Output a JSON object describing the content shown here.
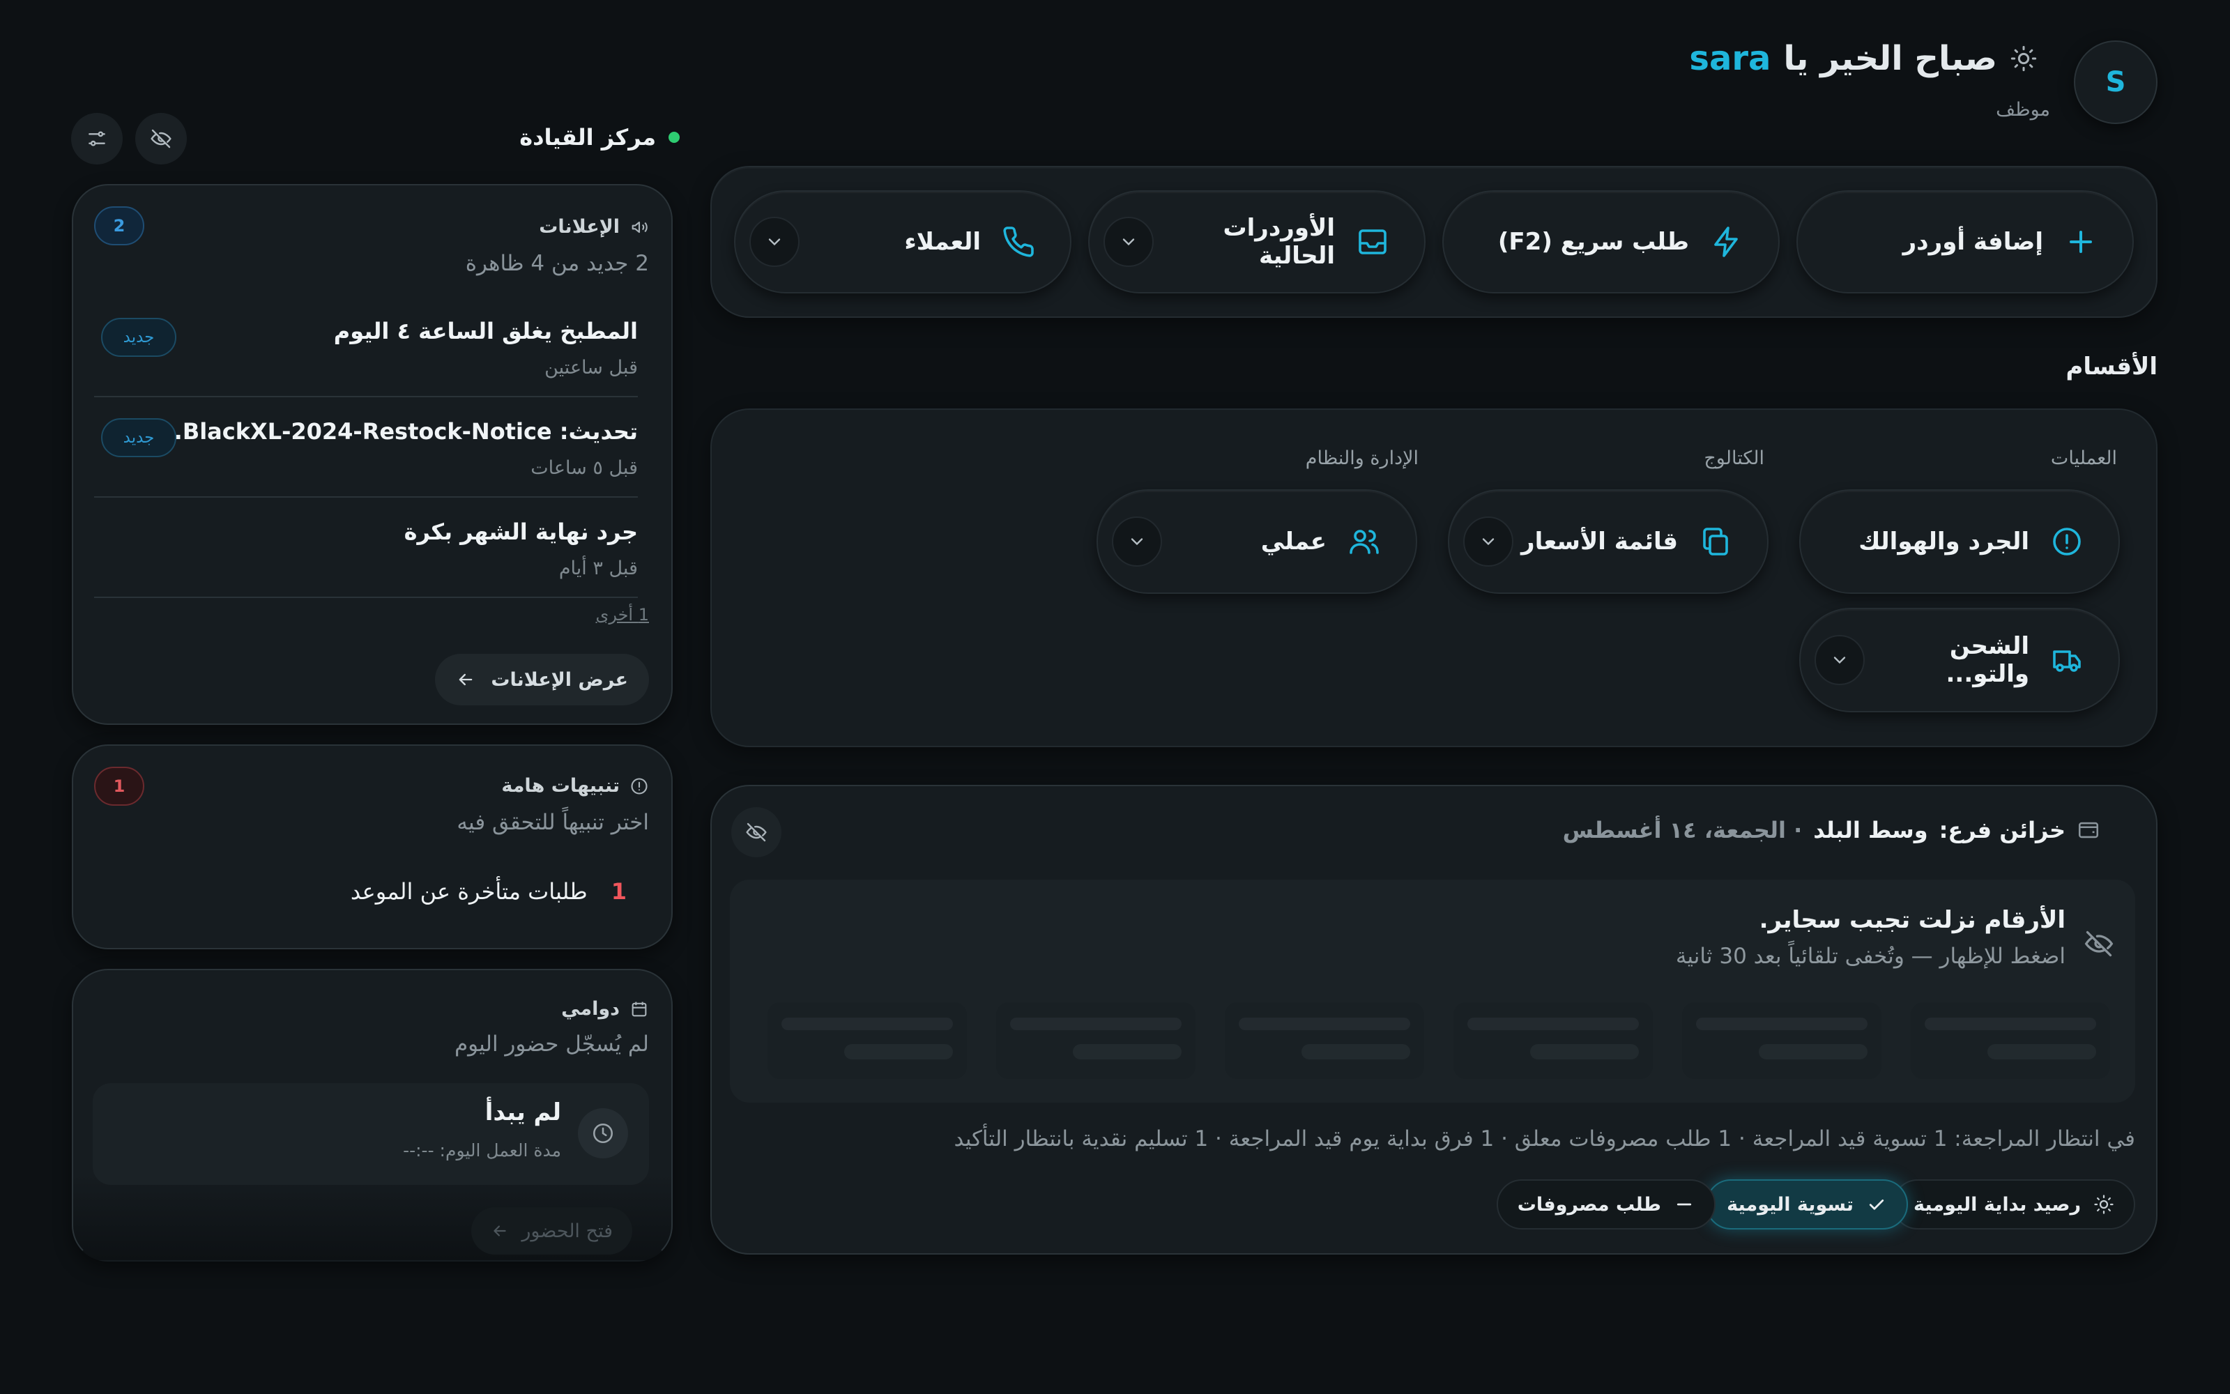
{
  "header": {
    "avatar_letter": "S",
    "greeting": "صباح الخير يا",
    "username": "sara",
    "role": "موظف"
  },
  "quick_actions": [
    {
      "label": "إضافة أوردر",
      "icon": "plus-icon"
    },
    {
      "label": "طلب سريع (F2)",
      "icon": "lightning-icon"
    },
    {
      "label": "الأوردرات الحالية",
      "icon": "inbox-icon",
      "has_dropdown": true
    },
    {
      "label": "العملاء",
      "icon": "phone-icon",
      "has_dropdown": true
    }
  ],
  "sections": {
    "title": "الأقسام",
    "groups": [
      {
        "heading": "العمليات",
        "items": [
          {
            "label": "الجرد والهوالك",
            "icon": "alert-circle-icon"
          },
          {
            "label": "الشحن والتو...",
            "icon": "truck-icon",
            "has_dropdown": true
          }
        ]
      },
      {
        "heading": "الكتالوج",
        "items": [
          {
            "label": "قائمة الأسعار",
            "icon": "copy-icon",
            "has_dropdown": true
          }
        ]
      },
      {
        "heading": "الإدارة والنظام",
        "items": [
          {
            "label": "عملي",
            "icon": "users-icon",
            "has_dropdown": true
          }
        ]
      }
    ]
  },
  "treasury": {
    "label": "خزائن فرع:",
    "branch": "وسط البلد",
    "date": "· الجمعة، ١٤ أغسطس",
    "hidden_title": "الأرقام نزلت تجيب سجاير.",
    "hidden_sub": "اضغط للإظهار — وتُخفى تلقائياً بعد 30 ثانية",
    "pending": "في انتظار المراجعة: 1 تسوية قيد المراجعة · 1 طلب مصروفات معلق · 1 فرق بداية يوم قيد المراجعة · 1 تسليم نقدية بانتظار التأكيد",
    "buttons": [
      {
        "label": "رصيد بداية اليومية",
        "icon": "sun-icon"
      },
      {
        "label": "تسوية اليومية",
        "icon": "check-icon",
        "active": true
      },
      {
        "label": "طلب مصروفات",
        "icon": "minus-icon"
      }
    ]
  },
  "command_center": {
    "title": "مركز القيادة"
  },
  "announcements": {
    "title": "الإعلانات",
    "count": "2",
    "subtitle": "2 جديد من 4 ظاهرة",
    "items": [
      {
        "title": "المطبخ يغلق الساعة ٤ اليوم",
        "time": "قبل ساعتين",
        "badge": "جديد"
      },
      {
        "title": "تحديث: BlackXL-2024-Restock-Notice...",
        "time": "قبل ٥ ساعات",
        "badge": "جديد"
      },
      {
        "title": "جرد نهاية الشهر بكرة",
        "time": "قبل ٣ أيام"
      }
    ],
    "more": "1 أخرى",
    "view_all": "عرض الإعلانات"
  },
  "alerts": {
    "title": "تنبيهات هامة",
    "count": "1",
    "subtitle": "اختر تنبيهاً للتحقق فيه",
    "item_count": "1",
    "item_label": "طلبات متأخرة عن الموعد"
  },
  "attendance": {
    "title": "دوامي",
    "subtitle": "لم يُسجّل حضور اليوم",
    "status": "لم يبدأ",
    "duration": "مدة العمل اليوم: --:--",
    "open_button": "فتح الحضور"
  }
}
